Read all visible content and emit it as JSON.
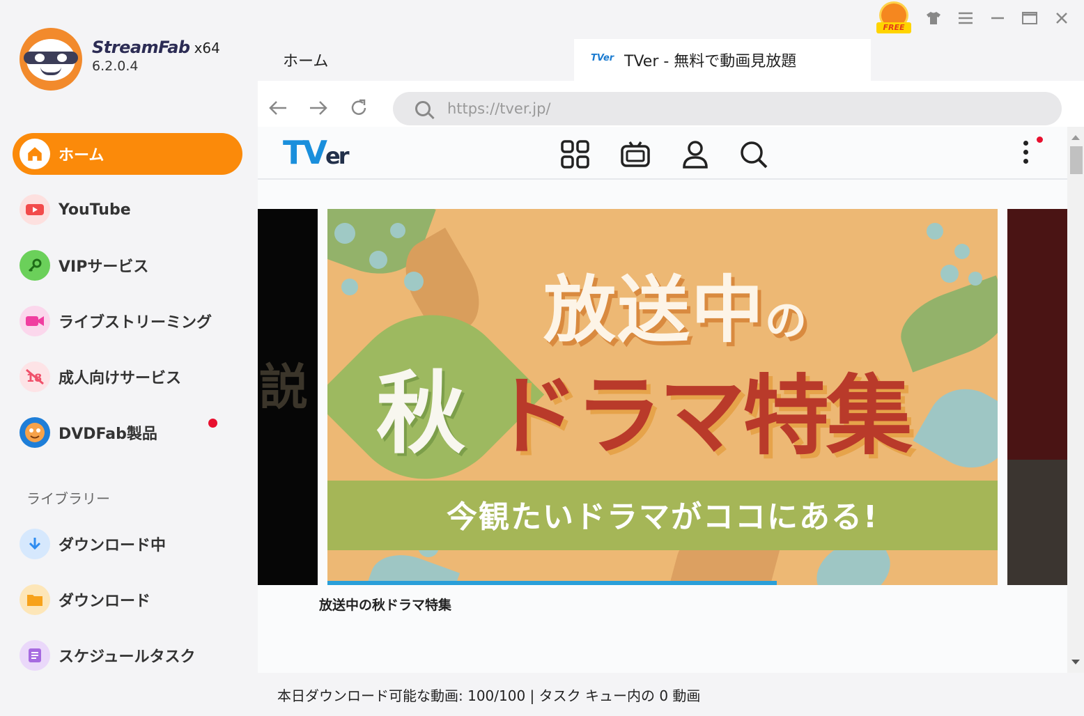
{
  "app": {
    "name": "StreamFab",
    "arch": "x64",
    "version": "6.2.0.4"
  },
  "window_controls": {
    "free_badge": "FREE"
  },
  "sidebar": {
    "items": [
      {
        "label": "ホーム",
        "icon": "home-icon",
        "color": "#fb8a0a",
        "active": true
      },
      {
        "label": "YouTube",
        "icon": "youtube-icon",
        "color": "#f24b4b"
      },
      {
        "label": "VIPサービス",
        "icon": "key-icon",
        "color": "#55c24a"
      },
      {
        "label": "ライブストリーミング",
        "icon": "video-camera-icon",
        "color": "#f03ea0"
      },
      {
        "label": "成人向けサービス",
        "icon": "adult-icon",
        "color": "#f0506a"
      },
      {
        "label": "DVDFab製品",
        "icon": "dvdfab-icon",
        "color": "#1e7ed8",
        "notification": true
      }
    ],
    "library_heading": "ライブラリー",
    "library_items": [
      {
        "label": "ダウンロード中",
        "icon": "download-arrow-icon",
        "color": "#2e8cf0"
      },
      {
        "label": "ダウンロード",
        "icon": "folder-icon",
        "color": "#f7a21b"
      },
      {
        "label": "スケジュールタスク",
        "icon": "task-list-icon",
        "color": "#a66ae0"
      }
    ]
  },
  "tabs": [
    {
      "label": "ホーム"
    },
    {
      "label": "TVer - 無料で動画見放題",
      "favicon": "TVer"
    }
  ],
  "browser": {
    "url": "https://tver.jp/"
  },
  "tver": {
    "logo_t": "TV",
    "logo_er": "er",
    "carousel": {
      "left_peek_text": "説",
      "banner": {
        "line1": "放送中",
        "line1_suffix": "の",
        "aki": "秋",
        "line2": "ドラマ特集",
        "tagline": "今観たいドラマがココにある!"
      },
      "progress": 0.67,
      "slide_title": "放送中の秋ドラマ特集"
    }
  },
  "status_bar": "本日ダウンロード可能な動画: 100/100 | タスク キュー内の 0 動画"
}
